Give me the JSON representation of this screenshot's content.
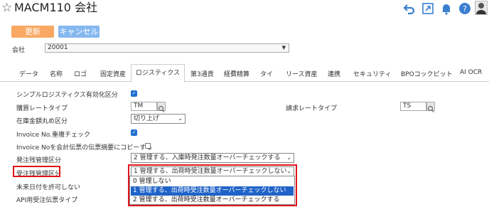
{
  "header": {
    "title": "MACM110 会社",
    "icons": [
      "star-icon",
      "undo-icon",
      "export-icon",
      "bell-icon",
      "help-icon",
      "avatar"
    ]
  },
  "toolbar": {
    "update_label": "更新",
    "cancel_label": "キャンセル"
  },
  "company": {
    "label": "会社",
    "value": "20001"
  },
  "tabs": [
    {
      "label": "データ"
    },
    {
      "label": "名称"
    },
    {
      "label": "ロゴ"
    },
    {
      "label": "固定資産"
    },
    {
      "label": "ロジスティクス",
      "active": true
    },
    {
      "label": "第3通貨"
    },
    {
      "label": "経費精算"
    },
    {
      "label": "タイ"
    },
    {
      "label": "リース資産"
    },
    {
      "label": "連携"
    },
    {
      "label": "セキュリティ"
    },
    {
      "label": "BPOコックピット"
    },
    {
      "label": "AI OCR"
    }
  ],
  "form": {
    "simple_logistics": {
      "label": "シンプルロジスティクス有効化区分",
      "checked": true
    },
    "purchase_rate": {
      "label": "購買レートタイプ",
      "value": "TM"
    },
    "billing_rate": {
      "label": "請求レートタイプ",
      "value": "TS"
    },
    "inventory_rounding": {
      "label": "在庫金額丸め区分",
      "value": "切り上げ"
    },
    "invoice_dup": {
      "label": "Invoice No.重複チェック",
      "checked": true
    },
    "invoice_copy": {
      "label": "Invoice Noを会計伝票の伝票摘要にコピーする",
      "checked": false
    },
    "po_balance": {
      "label": "発注残管理区分",
      "value": "2 管理する、入庫時発注数量オーバーチェックする"
    },
    "so_balance": {
      "label": "受注残管理区分",
      "value": "1 管理する、出荷時受注数量オーバーチェックしない"
    },
    "future_date": {
      "label": "未来日付を許可しない"
    },
    "api_order_type": {
      "label": "API用受注伝票タイプ"
    }
  },
  "dropdown": {
    "options": [
      "0 管理しない",
      "1 管理する、出荷時受注数量オーバーチェックしない",
      "2 管理する、出荷時受注数量オーバーチェックする"
    ],
    "selected_index": 1
  },
  "colors": {
    "update_button": "#f8a863",
    "cancel_button": "#86b8f0",
    "checkbox": "#1f6fd0",
    "highlight": "#e0141b",
    "selected_option": "#1f63c8"
  }
}
